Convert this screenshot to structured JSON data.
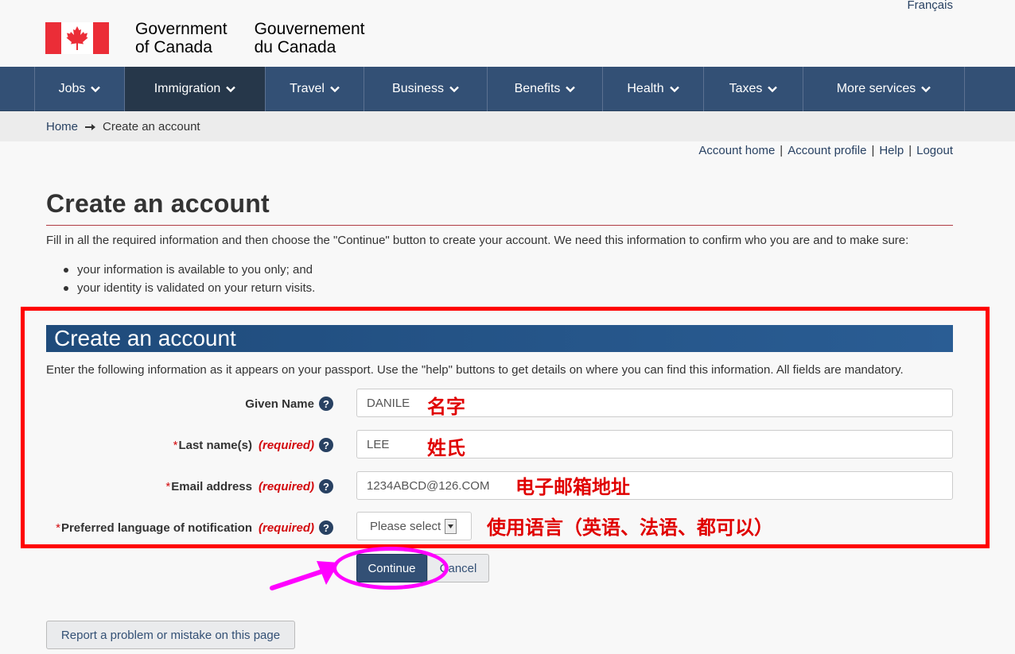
{
  "header": {
    "language_toggle": "Français",
    "brand_en_line1": "Government",
    "brand_en_line2": "of Canada",
    "brand_fr_line1": "Gouvernement",
    "brand_fr_line2": "du Canada",
    "flag_color": "#eb2d37"
  },
  "nav": {
    "items": [
      {
        "label": "Jobs",
        "active": false
      },
      {
        "label": "Immigration",
        "active": true
      },
      {
        "label": "Travel",
        "active": false
      },
      {
        "label": "Business",
        "active": false
      },
      {
        "label": "Benefits",
        "active": false
      },
      {
        "label": "Health",
        "active": false
      },
      {
        "label": "Taxes",
        "active": false
      },
      {
        "label": "More services",
        "active": false
      }
    ],
    "bg_color": "#335075"
  },
  "breadcrumb": {
    "home": "Home",
    "separator_icon": "arrow-right-icon",
    "current": "Create an account"
  },
  "account_links": {
    "home": "Account home",
    "profile": "Account profile",
    "help": "Help",
    "logout": "Logout",
    "separator": "|"
  },
  "main": {
    "title": "Create an account",
    "intro": "Fill in all the required information and then choose the \"Continue\" button to create your account. We need this information to confirm who you are and to make sure:",
    "bullets": [
      "your information is available to you only; and",
      "your identity is validated on your return visits."
    ]
  },
  "panel": {
    "title": "Create an account",
    "instructions": "Enter the following information as it appears on your passport. Use the \"help\" buttons to get details on where you can find this information. All fields are mandatory."
  },
  "form": {
    "required_marker": "*",
    "required_text": "(required)",
    "help_glyph": "?",
    "given_name": {
      "label": "Given Name",
      "value": "DANILE",
      "annotation": "名字"
    },
    "last_name": {
      "label": "Last name(s)",
      "value": "LEE",
      "annotation": "姓氏"
    },
    "email": {
      "label": "Email address",
      "value": "1234ABCD@126.COM",
      "annotation": "电子邮箱地址"
    },
    "language": {
      "label": "Preferred language of notification",
      "selected": "Please select",
      "annotation": "使用语言（英语、法语、都可以）"
    }
  },
  "buttons": {
    "continue": "Continue",
    "cancel": "Cancel",
    "report": "Report a problem or mistake on this page"
  },
  "annotations": {
    "box_color": "#ff0000",
    "highlight_color": "#ff00ff"
  }
}
